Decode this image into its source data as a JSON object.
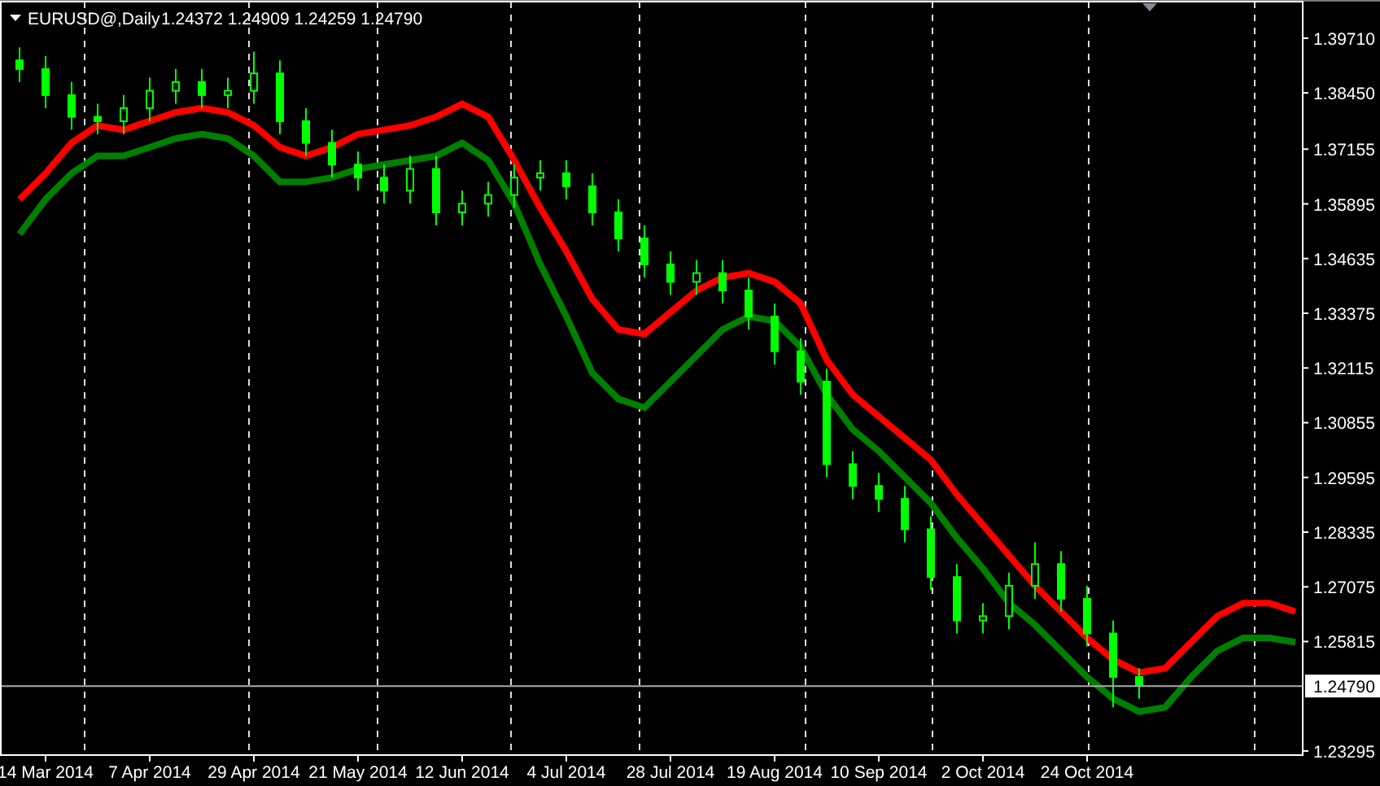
{
  "header": {
    "symbol": "EURUSD@,Daily",
    "prices": "1.24372 1.24909 1.24259 1.24790"
  },
  "chart_data": {
    "type": "candlestick",
    "grid": true,
    "ref_lines": [
      {
        "axis": "y",
        "value": 1.2479,
        "label": "1.24790",
        "color": "#aaaaaa"
      }
    ],
    "categories": [
      null,
      "14 Mar 2014",
      null,
      null,
      null,
      "7 Apr 2014",
      null,
      null,
      null,
      "29 Apr 2014",
      null,
      null,
      null,
      "21 May 2014",
      null,
      null,
      null,
      "12 Jun 2014",
      null,
      null,
      null,
      "4 Jul 2014",
      null,
      null,
      null,
      "28 Jul 2014",
      null,
      null,
      null,
      "19 Aug 2014",
      null,
      null,
      null,
      "10 Sep 2014",
      null,
      null,
      null,
      "2 Oct 2014",
      null,
      null,
      null,
      "24 Oct 2014",
      null,
      null,
      null,
      null,
      null,
      null,
      null,
      null
    ],
    "ylim": [
      1.232,
      1.4059
    ],
    "yticks": [
      {
        "value": 1.3971,
        "label": "1.39710"
      },
      {
        "value": 1.3845,
        "label": "1.38450"
      },
      {
        "value": 1.37155,
        "label": "1.37155"
      },
      {
        "value": 1.35895,
        "label": "1.35895"
      },
      {
        "value": 1.34635,
        "label": "1.34635"
      },
      {
        "value": 1.33375,
        "label": "1.33375"
      },
      {
        "value": 1.32115,
        "label": "1.32115"
      },
      {
        "value": 1.30855,
        "label": "1.30855"
      },
      {
        "value": 1.29595,
        "label": "1.29595"
      },
      {
        "value": 1.28335,
        "label": "1.28335"
      },
      {
        "value": 1.27075,
        "label": "1.27075"
      },
      {
        "value": 1.25815,
        "label": "1.25815"
      },
      {
        "value": 1.23295,
        "label": "1.23295"
      }
    ],
    "ohlc": [
      [
        1.392,
        1.395,
        1.387,
        1.39
      ],
      [
        1.39,
        1.393,
        1.381,
        1.384
      ],
      [
        1.384,
        1.387,
        1.376,
        1.379
      ],
      [
        1.379,
        1.382,
        1.375,
        1.378
      ],
      [
        1.378,
        1.384,
        1.375,
        1.381
      ],
      [
        1.381,
        1.388,
        1.378,
        1.385
      ],
      [
        1.385,
        1.39,
        1.382,
        1.387
      ],
      [
        1.387,
        1.39,
        1.381,
        1.384
      ],
      [
        1.384,
        1.388,
        1.381,
        1.385
      ],
      [
        1.385,
        1.394,
        1.382,
        1.389
      ],
      [
        1.389,
        1.392,
        1.375,
        1.378
      ],
      [
        1.378,
        1.381,
        1.37,
        1.373
      ],
      [
        1.373,
        1.376,
        1.365,
        1.368
      ],
      [
        1.368,
        1.371,
        1.362,
        1.365
      ],
      [
        1.365,
        1.368,
        1.359,
        1.362
      ],
      [
        1.362,
        1.37,
        1.359,
        1.367
      ],
      [
        1.367,
        1.37,
        1.354,
        1.357
      ],
      [
        1.357,
        1.362,
        1.354,
        1.359
      ],
      [
        1.359,
        1.364,
        1.356,
        1.361
      ],
      [
        1.361,
        1.368,
        1.358,
        1.365
      ],
      [
        1.365,
        1.369,
        1.362,
        1.366
      ],
      [
        1.366,
        1.369,
        1.36,
        1.363
      ],
      [
        1.363,
        1.366,
        1.354,
        1.357
      ],
      [
        1.357,
        1.36,
        1.348,
        1.351
      ],
      [
        1.351,
        1.354,
        1.342,
        1.345
      ],
      [
        1.345,
        1.348,
        1.338,
        1.341
      ],
      [
        1.341,
        1.346,
        1.338,
        1.343
      ],
      [
        1.343,
        1.346,
        1.336,
        1.339
      ],
      [
        1.339,
        1.342,
        1.33,
        1.333
      ],
      [
        1.333,
        1.336,
        1.322,
        1.325
      ],
      [
        1.325,
        1.328,
        1.315,
        1.318
      ],
      [
        1.318,
        1.321,
        1.296,
        1.299
      ],
      [
        1.299,
        1.302,
        1.291,
        1.294
      ],
      [
        1.294,
        1.297,
        1.288,
        1.291
      ],
      [
        1.291,
        1.294,
        1.281,
        1.284
      ],
      [
        1.284,
        1.287,
        1.27,
        1.273
      ],
      [
        1.273,
        1.276,
        1.26,
        1.263
      ],
      [
        1.263,
        1.267,
        1.26,
        1.264
      ],
      [
        1.264,
        1.274,
        1.261,
        1.271
      ],
      [
        1.271,
        1.281,
        1.268,
        1.276
      ],
      [
        1.276,
        1.279,
        1.265,
        1.268
      ],
      [
        1.268,
        1.271,
        1.257,
        1.26
      ],
      [
        1.26,
        1.263,
        1.243,
        1.25
      ],
      [
        1.25,
        1.252,
        1.245,
        1.248
      ],
      null,
      null,
      null,
      null,
      null,
      null
    ],
    "series": [
      {
        "type": "line",
        "color": "#ff0000",
        "values": [
          1.36,
          1.366,
          1.373,
          1.377,
          1.376,
          1.378,
          1.38,
          1.381,
          1.38,
          1.377,
          1.372,
          1.37,
          1.372,
          1.375,
          1.376,
          1.377,
          1.379,
          1.382,
          1.379,
          1.369,
          1.358,
          1.348,
          1.337,
          1.33,
          1.329,
          1.334,
          1.339,
          1.342,
          1.343,
          1.341,
          1.336,
          1.323,
          1.315,
          1.31,
          1.305,
          1.3,
          1.292,
          1.285,
          1.278,
          1.271,
          1.265,
          1.259,
          1.254,
          1.251,
          1.252,
          1.258,
          1.264,
          1.267,
          1.267,
          1.265
        ]
      },
      {
        "type": "line",
        "color": "#008000",
        "values": [
          1.352,
          1.36,
          1.366,
          1.37,
          1.37,
          1.372,
          1.374,
          1.375,
          1.374,
          1.37,
          1.364,
          1.364,
          1.365,
          1.367,
          1.368,
          1.369,
          1.37,
          1.373,
          1.369,
          1.359,
          1.345,
          1.333,
          1.32,
          1.314,
          1.312,
          1.318,
          1.324,
          1.33,
          1.333,
          1.332,
          1.326,
          1.315,
          1.307,
          1.302,
          1.296,
          1.29,
          1.282,
          1.275,
          1.267,
          1.262,
          1.256,
          1.25,
          1.245,
          1.242,
          1.243,
          1.25,
          1.256,
          1.259,
          1.259,
          1.258
        ]
      }
    ]
  }
}
